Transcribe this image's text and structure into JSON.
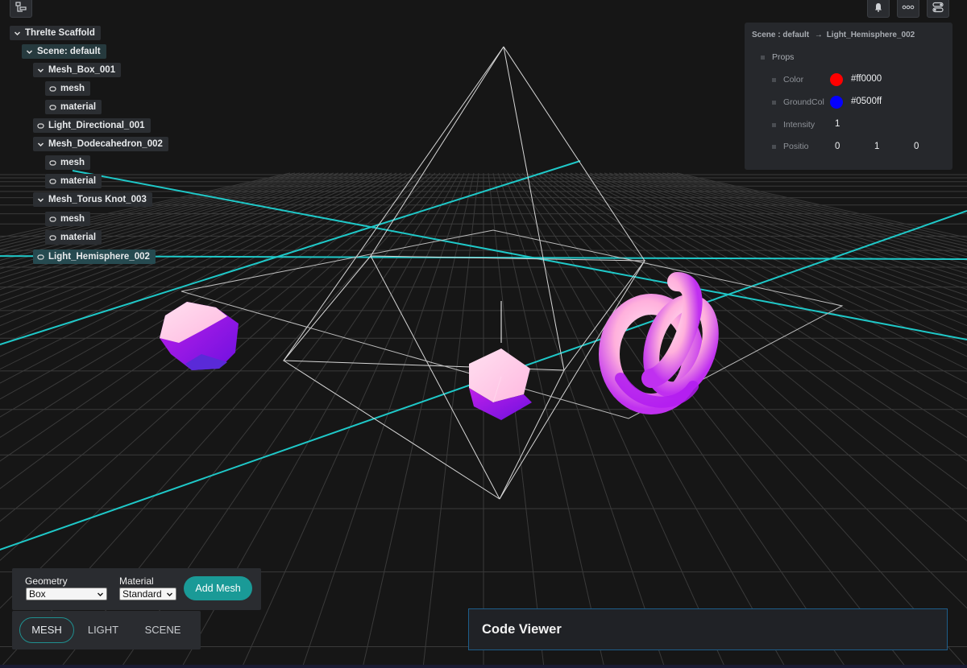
{
  "toolbar": {
    "left": {
      "icon": "hierarchy-icon"
    },
    "right": [
      {
        "icon": "bell-icon"
      },
      {
        "icon": "more-dots-icon"
      },
      {
        "icon": "toggles-icon"
      }
    ]
  },
  "tree": {
    "root": "Threlte Scaffold",
    "scene": "Scene: default",
    "box": "Mesh_Box_001",
    "box_mesh": "mesh",
    "box_material": "material",
    "light_dir": "Light_Directional_001",
    "dodeca": "Mesh_Dodecahedron_002",
    "dodeca_mesh": "mesh",
    "dodeca_material": "material",
    "torus": "Mesh_Torus Knot_003",
    "torus_mesh": "mesh",
    "torus_material": "material",
    "light_hemi": "Light_Hemisphere_002"
  },
  "props_panel": {
    "breadcrumb_scene": "Scene : default",
    "breadcrumb_arrow": "→",
    "breadcrumb_object": "Light_Hemisphere_002",
    "section": "Props",
    "color": {
      "label": "Color",
      "value": "#ff0000",
      "swatch": "#ff0000"
    },
    "ground": {
      "label": "GroundCol",
      "value": "#0500ff",
      "swatch": "#0500ff"
    },
    "intensity": {
      "label": "Intensity",
      "value": "1"
    },
    "position": {
      "label": "Positio",
      "x": "0",
      "y": "1",
      "z": "0"
    }
  },
  "mesh_controls": {
    "geometry_label": "Geometry",
    "geometry_value": "Box",
    "material_label": "Material",
    "material_value": "Standard",
    "add_button": "Add Mesh"
  },
  "mode_tabs": {
    "mesh": "MESH",
    "light": "LIGHT",
    "scene": "SCENE",
    "active": "MESH"
  },
  "code_viewer": {
    "title": "Code Viewer"
  },
  "colors": {
    "accent": "#1a9a97",
    "grid_axis": "#1fc8c8",
    "object_light": "#ffc8e6",
    "object_dark": "#a000e0"
  }
}
